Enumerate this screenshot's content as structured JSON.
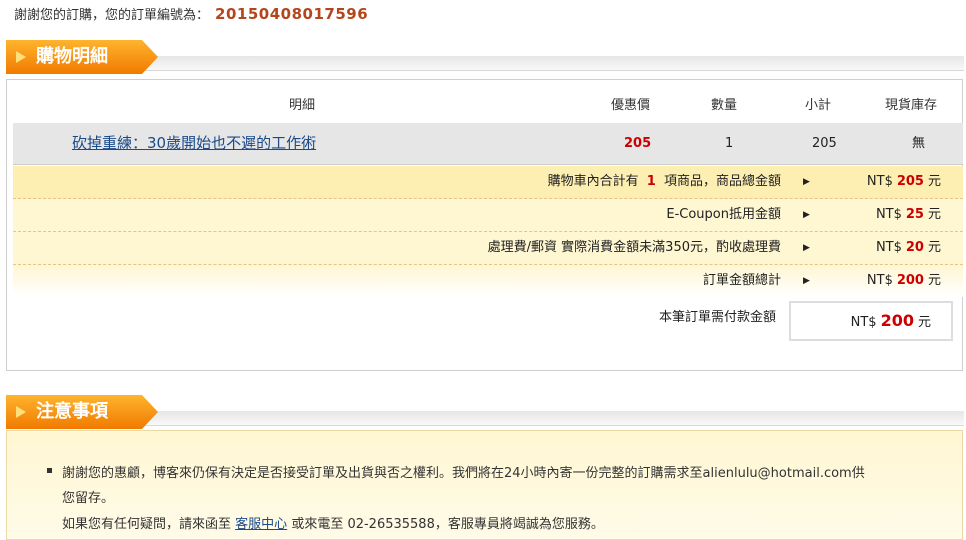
{
  "order": {
    "thanks_text": "謝謝您的訂購，您的訂單編號為：",
    "order_number": "20150408017596"
  },
  "cart_section": {
    "title": "購物明細"
  },
  "cart_header": {
    "col_detail": "明細",
    "col_price": "優惠價",
    "col_qty": "數量",
    "col_subtotal": "小計",
    "col_stock": "現貨庫存"
  },
  "items": [
    {
      "title": "砍掉重練：30歲開始也不遲的工作術",
      "price": "205",
      "qty": "1",
      "subtotal": "205",
      "stock": "無"
    }
  ],
  "summary": {
    "currency": "NT$",
    "unit": "元",
    "cart_total_label_pre": "購物車內合計有",
    "cart_item_count": "1",
    "cart_total_label_post": "項商品，商品總金額",
    "cart_total": "205",
    "coupon_label": "E-Coupon抵用金額",
    "coupon_amount": "25",
    "fee_label": "處理費/郵資 實際消費金額未滿350元，酌收處理費",
    "fee_amount": "20",
    "order_total_label": "訂單金額總計",
    "order_total": "200",
    "payable_label": "本筆訂單需付款金額",
    "payable_amount": "200"
  },
  "notes_section": {
    "title": "注意事項",
    "line1": "謝謝您的惠顧，博客來仍保有決定是否接受訂單及出貨與否之權利。我們將在24小時內寄一份完整的訂購需求至alienlulu@hotmail.com供",
    "line2": "您留存。",
    "line3_pre": "如果您有任何疑問，請來函至",
    "line3_link": "客服中心",
    "line3_post": "或來電至 02-26535588，客服專員將竭誠為您服務。"
  },
  "colors": {
    "accent_orange": "#f07a00",
    "price_red": "#cc0000",
    "link_blue": "#1a4a8a",
    "summary_yellow": "#fdefb2"
  }
}
